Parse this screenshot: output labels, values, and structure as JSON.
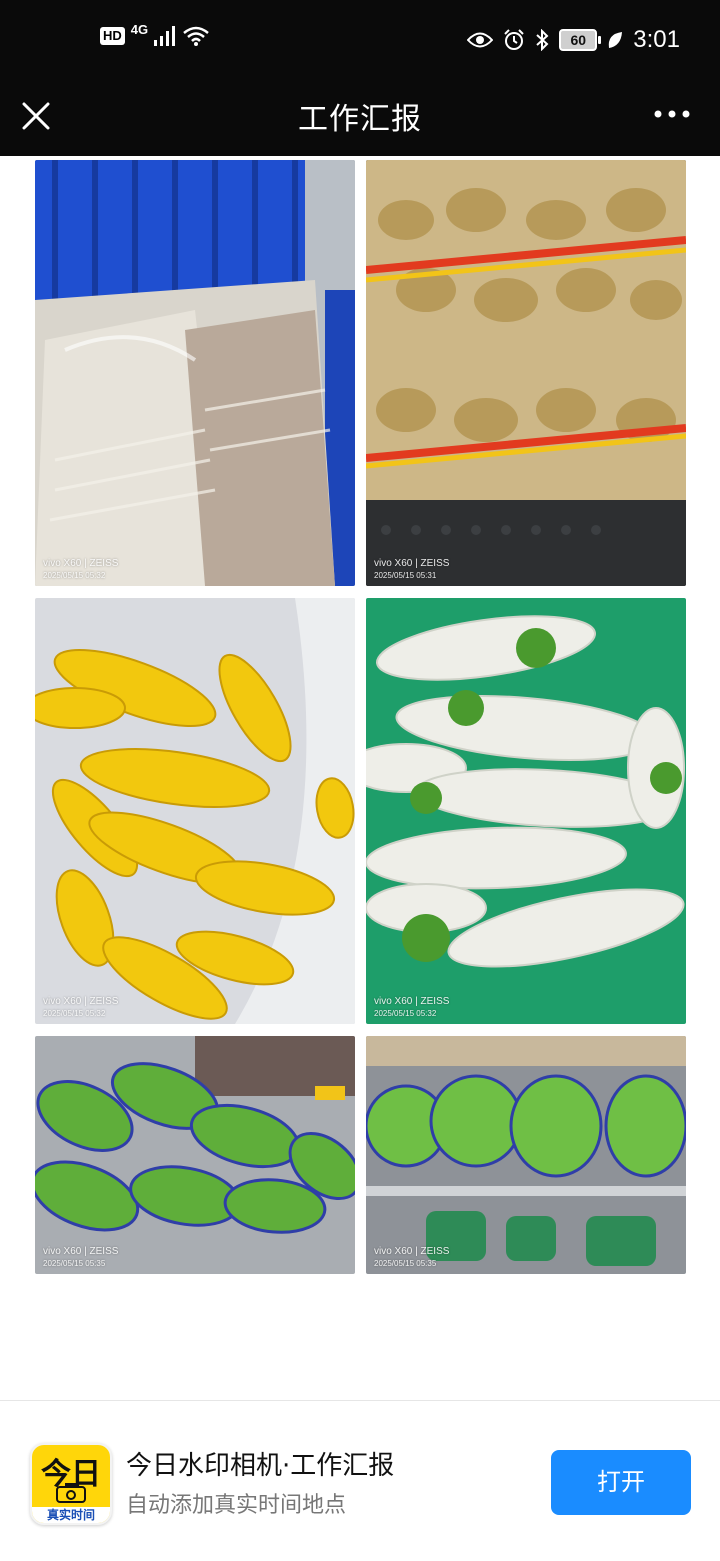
{
  "status_bar": {
    "hd": "HD",
    "network": "4G",
    "battery": "60",
    "time": "3:01",
    "icons": [
      "signal-icon",
      "wifi-icon",
      "eye-icon",
      "alarm-icon",
      "bluetooth-icon",
      "battery-icon",
      "leaf-icon"
    ]
  },
  "nav": {
    "title": "工作汇报",
    "close_icon": "close-icon",
    "more_icon": "more-icon"
  },
  "photos": [
    {
      "subject": "frozen food packs in blue crate",
      "camera": "vivo X60 | ZEISS",
      "date": "2025/05/15 05:32"
    },
    {
      "subject": "potatoes in mesh sacks",
      "camera": "vivo X60 | ZEISS",
      "date": "2025/05/15 05:31"
    },
    {
      "subject": "yellow corn cobs",
      "camera": "vivo X60 | ZEISS",
      "date": "2025/05/15 05:32"
    },
    {
      "subject": "white radishes",
      "camera": "vivo X60 | ZEISS",
      "date": "2025/05/15 05:32"
    },
    {
      "subject": "bagged green vegetables",
      "camera": "vivo X60 | ZEISS",
      "date": "2025/05/15 05:35"
    },
    {
      "subject": "bagged leafy greens on shelf",
      "camera": "vivo X60 | ZEISS",
      "date": "2025/05/15 05:35"
    }
  ],
  "promo": {
    "icon_big": "今日",
    "icon_small": "真实时间",
    "title": "今日水印相机·工作汇报",
    "subtitle": "自动添加真实时间地点",
    "button": "打开"
  }
}
